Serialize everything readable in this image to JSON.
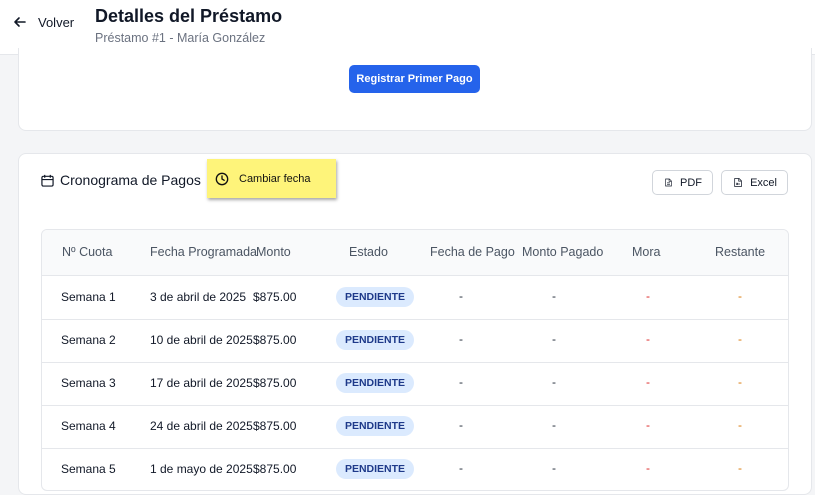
{
  "header": {
    "back_label": "Volver",
    "title": "Detalles del Préstamo",
    "subtitle": "Préstamo #1 - María González"
  },
  "actions": {
    "register_payment": "Registrar Primer Pago"
  },
  "schedule": {
    "title": "Cronograma de Pagos",
    "note": "Cambiar fecha",
    "pdf_label": "PDF",
    "excel_label": "Excel"
  },
  "table": {
    "columns": [
      "Nº Cuota",
      "Fecha Programada",
      "Monto",
      "Estado",
      "Fecha de Pago",
      "Monto Pagado",
      "Mora",
      "Restante"
    ],
    "rows": [
      {
        "cuota": "Semana 1",
        "fecha": "3 de abril de 2025",
        "monto": "$875.00",
        "estado": "PENDIENTE",
        "fecha_pago": "-",
        "monto_pagado": "-",
        "mora": "-",
        "restante": "-"
      },
      {
        "cuota": "Semana 2",
        "fecha": "10 de abril de 2025",
        "monto": "$875.00",
        "estado": "PENDIENTE",
        "fecha_pago": "-",
        "monto_pagado": "-",
        "mora": "-",
        "restante": "-"
      },
      {
        "cuota": "Semana 3",
        "fecha": "17 de abril de 2025",
        "monto": "$875.00",
        "estado": "PENDIENTE",
        "fecha_pago": "-",
        "monto_pagado": "-",
        "mora": "-",
        "restante": "-"
      },
      {
        "cuota": "Semana 4",
        "fecha": "24 de abril de 2025",
        "monto": "$875.00",
        "estado": "PENDIENTE",
        "fecha_pago": "-",
        "monto_pagado": "-",
        "mora": "-",
        "restante": "-"
      },
      {
        "cuota": "Semana 5",
        "fecha": "1 de mayo de 2025",
        "monto": "$875.00",
        "estado": "PENDIENTE",
        "fecha_pago": "-",
        "monto_pagado": "-",
        "mora": "-",
        "restante": "-"
      }
    ]
  },
  "colors": {
    "primary": "#2563eb",
    "badge_bg": "#dbeafe",
    "badge_text": "#1e3a8a",
    "mora": "#dc2626",
    "restante": "#d97706",
    "note_bg": "#fef47a"
  },
  "icons": [
    "arrow-left-icon",
    "calendar-icon",
    "clock-icon",
    "pdf-file-icon",
    "excel-file-icon"
  ]
}
